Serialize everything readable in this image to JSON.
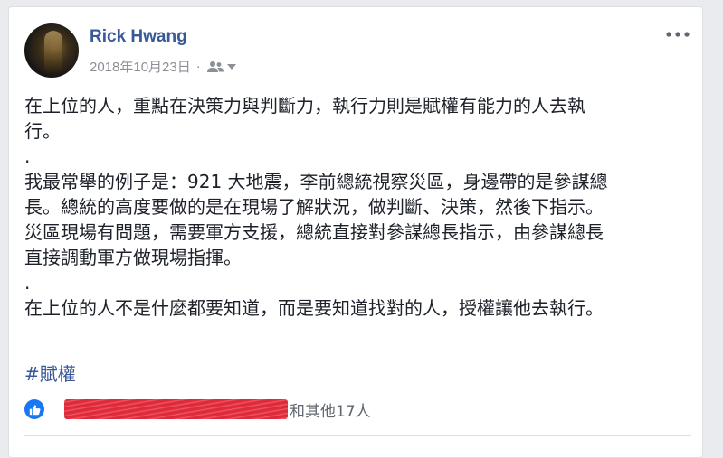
{
  "post": {
    "author": "Rick Hwang",
    "date": "2018年10月23日",
    "separator": "·",
    "paragraphs": [
      "在上位的人，重點在決策力與判斷力，執行力則是賦權有能力的人去執\n行。",
      ".",
      "我最常舉的例子是：921 大地震，李前總統視察災區，身邊帶的是參謀總\n長。總統的高度要做的是在現場了解狀況，做判斷、決策，然後下指示。\n災區現場有問題，需要軍方支援，總統直接對參謀總長指示，由參謀總長\n直接調動軍方做現場指揮。",
      ".",
      "在上位的人不是什麼都要知道，而是要知道找對的人，授權讓他去執行。"
    ],
    "hashtag": "#賦權"
  },
  "reactions": {
    "summary": "和其他17人",
    "like_color": "#1877f2"
  },
  "icons": {
    "audience": "friends-icon",
    "audience_dropdown": "caret-down-icon",
    "more": "more-options-icon",
    "like": "like-icon"
  },
  "colors": {
    "author_link": "#385898",
    "body_text": "#1d2129",
    "meta_text": "#8b8f96",
    "redaction": "#e0182a"
  }
}
